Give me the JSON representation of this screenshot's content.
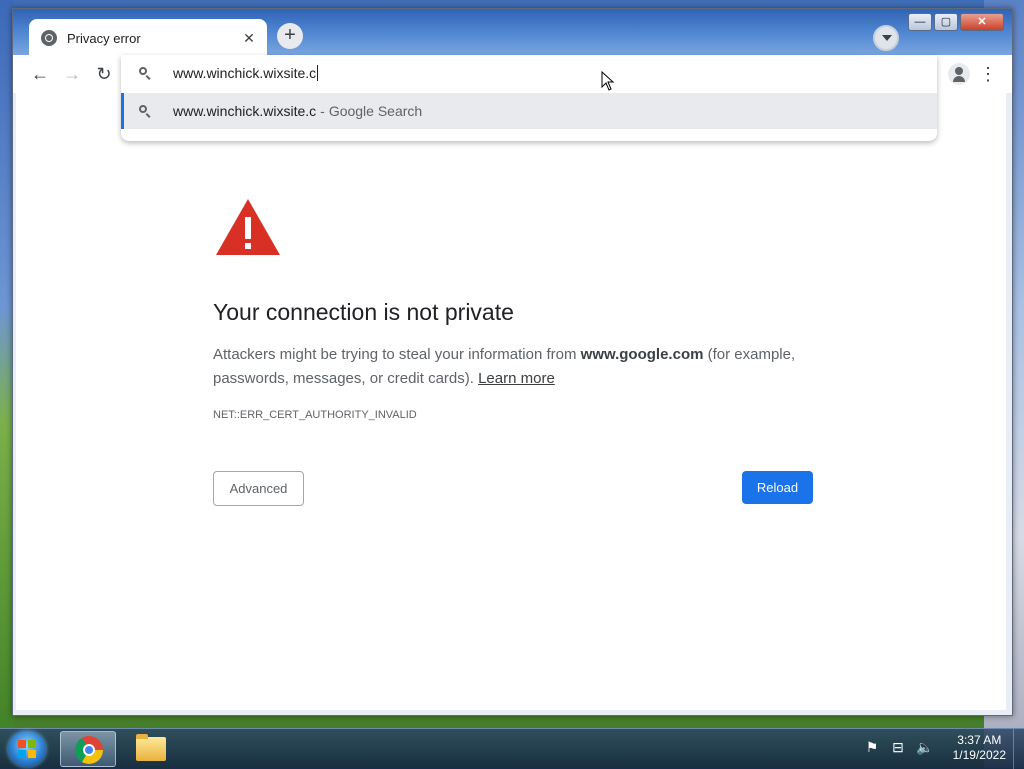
{
  "browser": {
    "tab": {
      "title": "Privacy error",
      "close": "✕"
    },
    "new_tab": "+",
    "nav": {
      "back": "←",
      "forward": "→",
      "reload": "↻"
    },
    "menu": "⋮",
    "window_controls": {
      "minimize": "—",
      "maximize": "▢",
      "close": "✕"
    }
  },
  "omnibox": {
    "input_value": "www.winchick.wixsite.c",
    "suggestion": {
      "text": "www.winchick.wixsite.c",
      "separator": "-",
      "engine": "Google Search"
    }
  },
  "page": {
    "heading": "Your connection is not private",
    "description_pre": "Attackers might be trying to steal your information from ",
    "domain": "www.google.com",
    "description_post": " (for example, passwords, messages, or credit cards). ",
    "learn_more": "Learn more",
    "error_code": "NET::ERR_CERT_AUTHORITY_INVALID",
    "advanced_button": "Advanced",
    "reload_button": "Reload"
  },
  "taskbar": {
    "time": "3:37 AM",
    "date": "1/19/2022",
    "tray_icons": [
      "flag-icon",
      "network-icon",
      "volume-icon"
    ]
  },
  "colors": {
    "accent": "#1a73e8",
    "warning_red": "#d93025"
  }
}
